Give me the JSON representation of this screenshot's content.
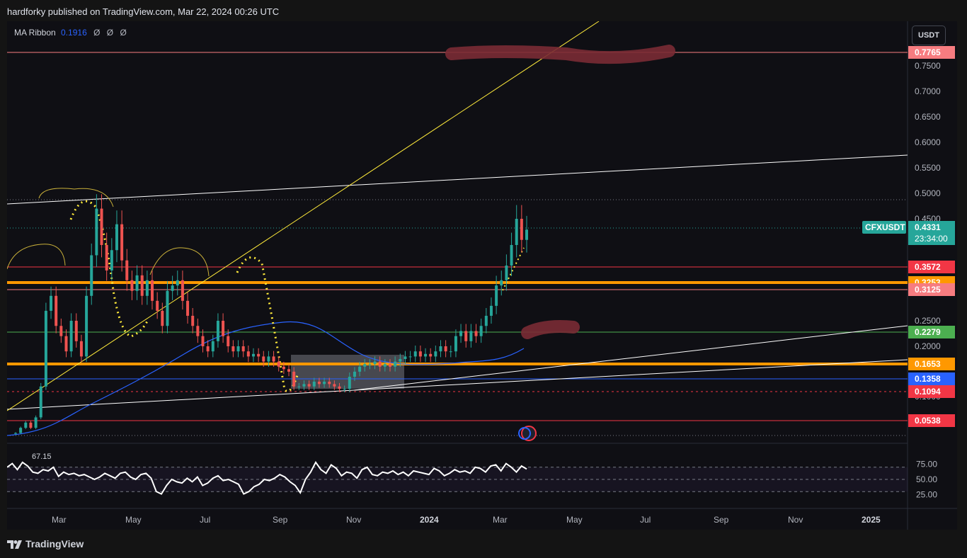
{
  "header": {
    "published": "hardforky published on TradingView.com, Mar 22, 2024 00:26 UTC"
  },
  "indicator": {
    "name": "MA Ribbon",
    "value": "0.1916",
    "empty_values": [
      "Ø",
      "Ø",
      "Ø"
    ]
  },
  "currency_button": "USDT",
  "rsi": {
    "value_label": "67.15",
    "scale": [
      "75.00",
      "50.00",
      "25.00"
    ]
  },
  "footer": {
    "brand": "TradingView"
  },
  "colors": {
    "up": "#26a69a",
    "down": "#ef5350",
    "orange": "#ff9800",
    "ma_blue": "#2962ff",
    "rsi_line": "#ffffff",
    "yellow": "#ffeb3b"
  },
  "chart_data": {
    "type": "candlestick",
    "symbol": "CFXUSDT",
    "y_ticks": [
      "0.7500",
      "0.7000",
      "0.6500",
      "0.6000",
      "0.5500",
      "0.5000",
      "0.4500",
      "0.2500",
      "0.2000",
      "0.1000"
    ],
    "x_ticks": [
      "Mar",
      "May",
      "Jul",
      "Sep",
      "Nov",
      "2024",
      "Mar",
      "May",
      "Jul",
      "Sep",
      "Nov",
      "2025"
    ],
    "price_labels": [
      {
        "text": "0.7765",
        "price": 0.7765,
        "color": "#f77c80",
        "line": "#f77c80"
      },
      {
        "text": "0.4331",
        "price": 0.4331,
        "color": "#26a69a",
        "line": "#26a69a",
        "sub": "23:34:00",
        "symbol": "CFXUSDT"
      },
      {
        "text": "0.3572",
        "price": 0.3572,
        "color": "#f23645",
        "line": "#f23645"
      },
      {
        "text": "0.3253",
        "price": 0.3253,
        "color": "#ff9800",
        "line": "#ff9800"
      },
      {
        "text": "0.3125",
        "price": 0.3125,
        "color": "#f77c80",
        "line": "#f77c80"
      },
      {
        "text": "0.2279",
        "price": 0.2279,
        "color": "#4caf50",
        "line": "#4caf50"
      },
      {
        "text": "0.1653",
        "price": 0.1653,
        "color": "#ff9800",
        "line": "#ff9800"
      },
      {
        "text": "0.1358",
        "price": 0.1358,
        "color": "#2962ff",
        "line": "#2962ff"
      },
      {
        "text": "0.1094",
        "price": 0.1094,
        "color": "#f23645",
        "line": "#f23645"
      },
      {
        "text": "0.0538",
        "price": 0.0538,
        "color": "#f23645",
        "line": "#f23645"
      }
    ],
    "close_series": [
      0.03,
      0.04,
      0.05,
      0.04,
      0.06,
      0.12,
      0.27,
      0.3,
      0.24,
      0.22,
      0.19,
      0.25,
      0.21,
      0.18,
      0.3,
      0.38,
      0.47,
      0.4,
      0.35,
      0.39,
      0.44,
      0.37,
      0.33,
      0.31,
      0.34,
      0.3,
      0.33,
      0.29,
      0.27,
      0.24,
      0.31,
      0.32,
      0.33,
      0.29,
      0.26,
      0.24,
      0.22,
      0.2,
      0.19,
      0.21,
      0.25,
      0.22,
      0.2,
      0.19,
      0.2,
      0.19,
      0.18,
      0.185,
      0.18,
      0.17,
      0.18,
      0.17,
      0.16,
      0.155,
      0.15,
      0.12,
      0.12,
      0.125,
      0.12,
      0.13,
      0.125,
      0.13,
      0.125,
      0.12,
      0.115,
      0.115,
      0.14,
      0.15,
      0.16,
      0.165,
      0.165,
      0.17,
      0.16,
      0.165,
      0.16,
      0.17,
      0.175,
      0.18,
      0.18,
      0.19,
      0.18,
      0.185,
      0.18,
      0.19,
      0.2,
      0.19,
      0.19,
      0.22,
      0.23,
      0.21,
      0.23,
      0.22,
      0.24,
      0.26,
      0.28,
      0.32,
      0.33,
      0.36,
      0.4,
      0.45,
      0.41,
      0.43
    ],
    "rsi_series": [
      70,
      76,
      66,
      78,
      72,
      62,
      60,
      66,
      64,
      70,
      55,
      62,
      58,
      60,
      56,
      58,
      54,
      50,
      54,
      60,
      56,
      52,
      60,
      62,
      54,
      50,
      58,
      60,
      52,
      30,
      26,
      40,
      50,
      46,
      44,
      52,
      46,
      54,
      40,
      44,
      52,
      56,
      48,
      50,
      46,
      42,
      26,
      30,
      38,
      42,
      50,
      48,
      52,
      58,
      54,
      46,
      40,
      28,
      50,
      62,
      78,
      66,
      60,
      74,
      68,
      56,
      62,
      60,
      52,
      66,
      70,
      58,
      56,
      62,
      60,
      64,
      58,
      62,
      56,
      64,
      62,
      60,
      58,
      68,
      64,
      56,
      60,
      66,
      62,
      64,
      60,
      70,
      68,
      62,
      72,
      74,
      64,
      76,
      70,
      62,
      72,
      67
    ]
  }
}
